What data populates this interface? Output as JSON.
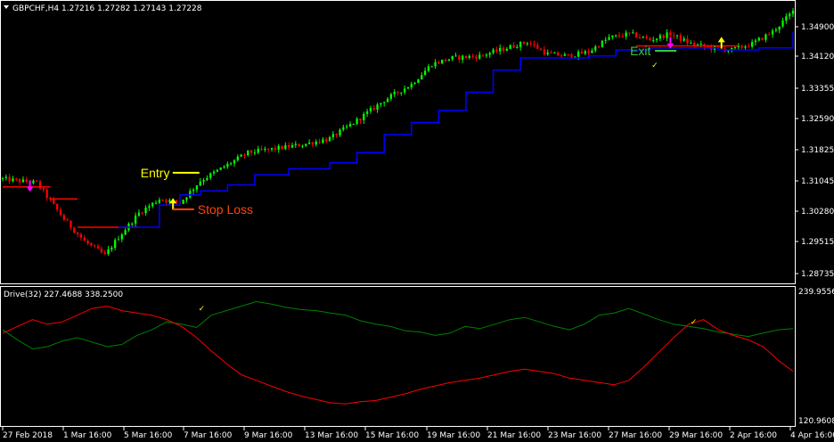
{
  "main_title": "GBPCHF,H4  1.27216 1.27282 1.27143 1.27228",
  "indicator_title": "Drive(32) 227.4688 338.2500",
  "colors": {
    "bull": "#00ff00",
    "bear": "#ff0000",
    "trail_up": "#0000ff",
    "trail_down": "#ff0000",
    "drive_green": "#008000",
    "drive_red": "#ff0000",
    "entry": "#ffff00",
    "stop": "#ff4500",
    "exit": "#32cd32",
    "arrow_down": "#ff00ff",
    "arrow_up": "#ffff00",
    "grid_frame": "#ffffff"
  },
  "chart_data": [
    {
      "type": "candlestick",
      "title": "GBPCHF,H4",
      "price_ticks": [
        "1.34900",
        "1.34120",
        "1.33355",
        "1.32590",
        "1.31825",
        "1.31045",
        "1.30280",
        "1.29515",
        "1.28735"
      ],
      "date_ticks": [
        "27 Feb 2018",
        "1 Mar 16:00",
        "5 Mar 16:00",
        "7 Mar 16:00",
        "9 Mar 16:00",
        "13 Mar 16:00",
        "15 Mar 16:00",
        "19 Mar 16:00",
        "21 Mar 16:00",
        "23 Mar 16:00",
        "27 Mar 16:00",
        "29 Mar 16:00",
        "2 Apr 16:00",
        "4 Apr 16:00"
      ],
      "ylim": [
        1.283,
        1.352
      ],
      "close_path": [
        [
          0,
          1.3085
        ],
        [
          10,
          1.3075
        ],
        [
          18,
          1.2985
        ],
        [
          24,
          1.293
        ],
        [
          30,
          1.2895
        ],
        [
          34,
          1.294
        ],
        [
          40,
          1.3
        ],
        [
          46,
          1.3035
        ],
        [
          52,
          1.3025
        ],
        [
          58,
          1.308
        ],
        [
          64,
          1.311
        ],
        [
          72,
          1.315
        ],
        [
          80,
          1.316
        ],
        [
          88,
          1.317
        ],
        [
          96,
          1.3185
        ],
        [
          104,
          1.323
        ],
        [
          112,
          1.328
        ],
        [
          120,
          1.332
        ],
        [
          126,
          1.337
        ],
        [
          132,
          1.3385
        ],
        [
          140,
          1.339
        ],
        [
          148,
          1.341
        ],
        [
          154,
          1.3425
        ],
        [
          160,
          1.3395
        ],
        [
          166,
          1.339
        ],
        [
          172,
          1.34
        ],
        [
          178,
          1.3435
        ],
        [
          184,
          1.3445
        ],
        [
          190,
          1.343
        ],
        [
          196,
          1.3445
        ],
        [
          202,
          1.342
        ],
        [
          208,
          1.341
        ],
        [
          214,
          1.3405
        ],
        [
          220,
          1.342
        ],
        [
          226,
          1.345
        ],
        [
          232,
          1.35
        ]
      ],
      "trail": [
        {
          "x0": 0,
          "x1": 14,
          "price": 1.3065,
          "dir": "down"
        },
        {
          "x0": 14,
          "x1": 22,
          "price": 1.3035,
          "dir": "down"
        },
        {
          "x0": 22,
          "x1": 40,
          "price": 1.2965,
          "dir": "down"
        },
        {
          "x0": 34,
          "x1": 232,
          "dir": "up",
          "path": [
            [
              34,
              1.2965
            ],
            [
              40,
              1.2965
            ],
            [
              46,
              1.302
            ],
            [
              52,
              1.3045
            ],
            [
              58,
              1.3055
            ],
            [
              66,
              1.307
            ],
            [
              74,
              1.3095
            ],
            [
              84,
              1.311
            ],
            [
              96,
              1.3125
            ],
            [
              104,
              1.315
            ],
            [
              112,
              1.3195
            ],
            [
              120,
              1.3225
            ],
            [
              128,
              1.3255
            ],
            [
              136,
              1.33
            ],
            [
              144,
              1.3355
            ],
            [
              152,
              1.3385
            ],
            [
              162,
              1.3385
            ],
            [
              172,
              1.339
            ],
            [
              180,
              1.3405
            ],
            [
              190,
              1.341
            ],
            [
              202,
              1.341
            ],
            [
              210,
              1.3405
            ],
            [
              222,
              1.341
            ],
            [
              232,
              1.345
            ]
          ]
        },
        {
          "x0": 186,
          "x1": 216,
          "price": 1.3415,
          "dir": "down"
        }
      ],
      "annotations": [
        {
          "label": "Entry",
          "bar": 52,
          "price": 1.31,
          "kind": "entry"
        },
        {
          "label": "Stop Loss",
          "bar": 52,
          "price": 1.3025,
          "kind": "stop"
        },
        {
          "label": "Exit",
          "bar": 192,
          "price": 1.3385,
          "kind": "exit"
        }
      ],
      "signal_arrows": [
        {
          "bar": 8,
          "price": 1.3055,
          "dir": "down"
        },
        {
          "bar": 50,
          "price": 1.3035,
          "dir": "up"
        },
        {
          "bar": 196,
          "price": 1.341,
          "dir": "down"
        },
        {
          "bar": 211,
          "price": 1.3435,
          "dir": "up"
        }
      ]
    },
    {
      "type": "line",
      "title": "Drive(32)",
      "value_ticks": [
        "239.9556",
        "120.9608"
      ],
      "ylim": [
        120.9608,
        239.9556
      ],
      "series": [
        {
          "color": "green",
          "values": [
            205,
            196,
            188,
            190,
            195,
            198,
            194,
            190,
            192,
            200,
            205,
            212,
            210,
            207,
            218,
            222,
            226,
            230,
            228,
            225,
            223,
            222,
            220,
            218,
            213,
            210,
            208,
            204,
            203,
            200,
            202,
            208,
            206,
            210,
            214,
            216,
            212,
            208,
            205,
            210,
            218,
            220,
            224,
            219,
            214,
            210,
            208,
            206,
            203,
            201,
            199,
            202,
            205,
            206
          ]
        },
        {
          "color": "red",
          "values": [
            202,
            208,
            214,
            210,
            212,
            218,
            224,
            226,
            222,
            220,
            218,
            214,
            208,
            198,
            186,
            175,
            165,
            160,
            155,
            150,
            146,
            143,
            140,
            139,
            141,
            142,
            145,
            148,
            152,
            155,
            158,
            160,
            162,
            165,
            168,
            170,
            168,
            166,
            162,
            160,
            158,
            156,
            160,
            172,
            185,
            198,
            210,
            214,
            205,
            200,
            196,
            190,
            178,
            168
          ]
        }
      ],
      "marks": [
        {
          "index": 13,
          "value": 224
        },
        {
          "index": 46,
          "value": 212
        }
      ]
    }
  ]
}
